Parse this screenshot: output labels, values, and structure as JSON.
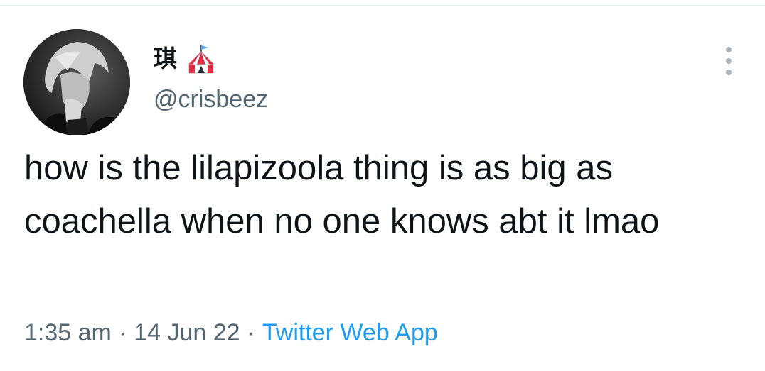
{
  "tweet": {
    "author": {
      "display_name": "琪",
      "badge_icon": "circus-tent-icon",
      "handle": "@crisbeez",
      "avatar_icon": "profile-photo"
    },
    "menu_icon": "more-vertical-icon",
    "text": "how is the lilapizoola thing is as big as coachella when no one knows abt it lmao",
    "time": "1:35 am",
    "date": "14 Jun 22",
    "separator": "·",
    "source": "Twitter Web App"
  },
  "colors": {
    "text_primary": "#0f1419",
    "text_secondary": "#536471",
    "link": "#1d9bf0",
    "menu_dots": "#a8b4bd"
  }
}
